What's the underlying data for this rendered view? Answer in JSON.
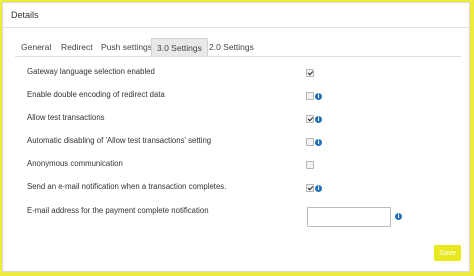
{
  "panel": {
    "title": "Details"
  },
  "tabs": [
    {
      "label": "General",
      "active": false
    },
    {
      "label": "Redirect",
      "active": false
    },
    {
      "label": "Push settings",
      "active": false
    },
    {
      "label": "3.0 Settings",
      "active": true
    },
    {
      "label": "2.0 Settings",
      "active": false
    }
  ],
  "settings": [
    {
      "label": "Gateway language selection enabled",
      "checked": true,
      "info": false
    },
    {
      "label": "Enable double encoding of redirect data",
      "checked": false,
      "info": true
    },
    {
      "label": "Allow test transactions",
      "checked": true,
      "info": true
    },
    {
      "label": "Automatic disabling of 'Allow test transactions' setting",
      "checked": false,
      "info": true
    },
    {
      "label": "Anonymous communication",
      "checked": false,
      "info": false
    },
    {
      "label": "Send an e-mail notification when a transaction completes.",
      "checked": true,
      "info": true
    }
  ],
  "email_setting": {
    "label": "E-mail address for the payment complete notification",
    "value": ""
  },
  "buttons": {
    "save_label": "Save"
  },
  "icons": {
    "info": "info-icon",
    "info_glyph": "i"
  },
  "colors": {
    "accent": "#e8e81f",
    "info": "#1f6fb8",
    "background": "#ecec3c"
  }
}
